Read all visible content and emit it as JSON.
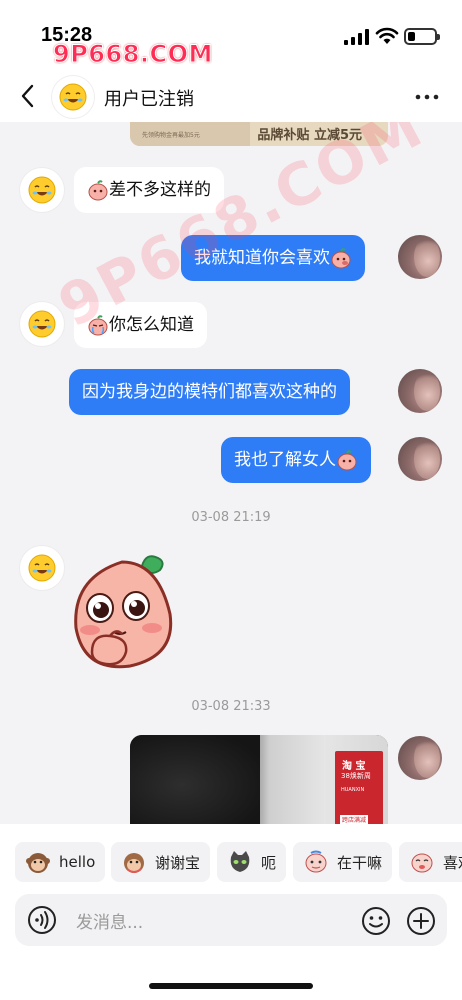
{
  "status_bar": {
    "time": "15:28",
    "watermark": "9P668.COM"
  },
  "header": {
    "title": "用户已注销"
  },
  "chat": {
    "top_card_text": "品牌补贴 立减5元",
    "top_card_small": "先领购物金再最加5元",
    "watermark": "9P668.COM",
    "messages": [
      {
        "side": "in",
        "text": "差不多这样的"
      },
      {
        "side": "out",
        "text": "我就知道你会喜欢"
      },
      {
        "side": "in",
        "text": "你怎么知道"
      },
      {
        "side": "out",
        "text": "因为我身边的模特们都喜欢这种的"
      },
      {
        "side": "out",
        "text": "我也了解女人"
      }
    ],
    "timestamps": [
      "03-08 21:19",
      "03-08 21:33"
    ],
    "image_card": {
      "title": "淘 宝",
      "subtitle": "38焕新周",
      "small": "HUANXIN",
      "bottom": "跨店满减"
    }
  },
  "quick_replies": [
    "hello",
    "谢谢宝",
    "呃",
    "在干嘛",
    "喜欢"
  ],
  "input": {
    "placeholder": "发消息..."
  },
  "colors": {
    "accent": "#2f7df6",
    "chat_bg": "#f3f3f5",
    "bubble_in": "#ffffff"
  }
}
